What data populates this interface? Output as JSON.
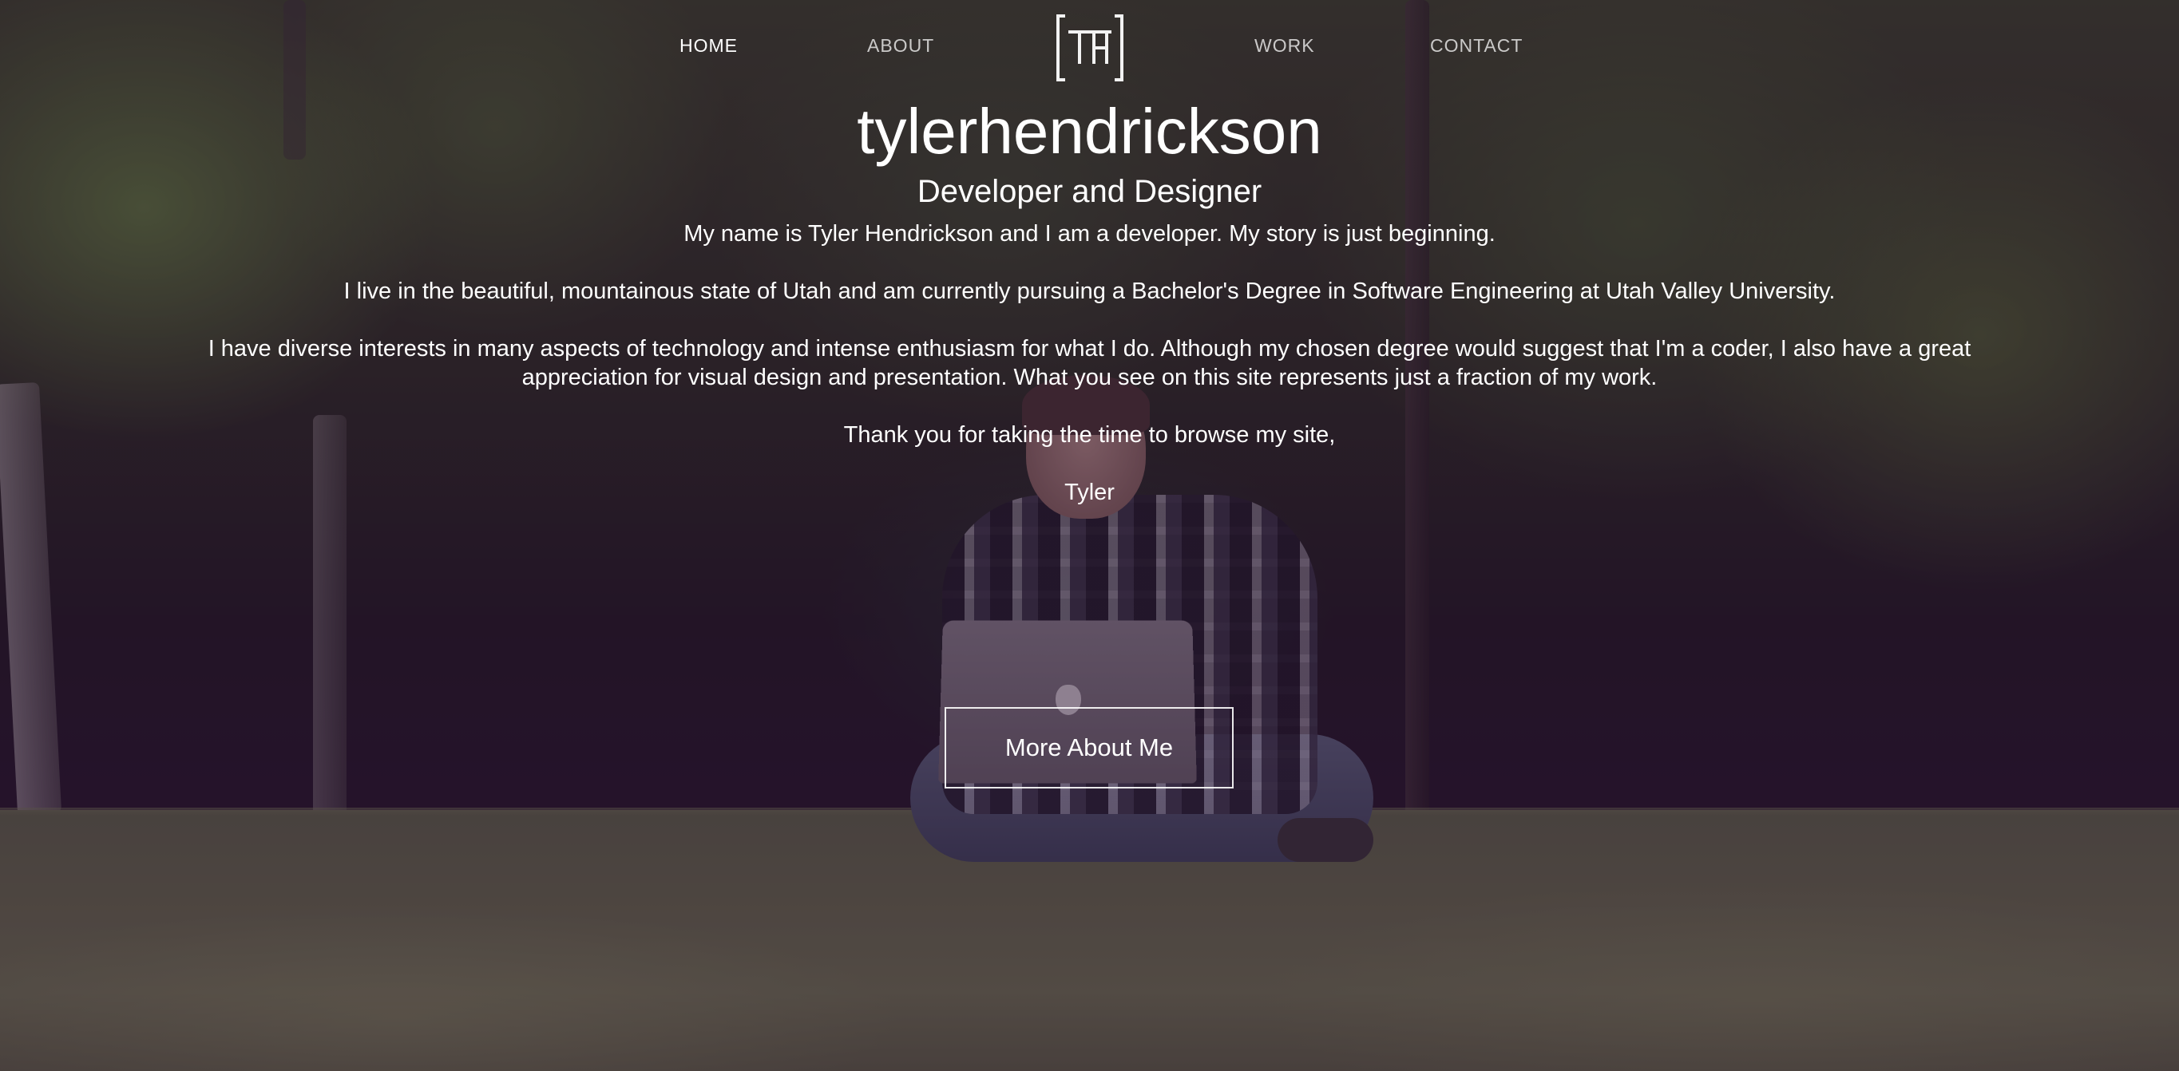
{
  "nav": {
    "items": [
      {
        "label": "HOME",
        "active": true
      },
      {
        "label": "ABOUT",
        "active": false
      },
      {
        "label": "WORK",
        "active": false
      },
      {
        "label": "CONTACT",
        "active": false
      }
    ],
    "logo_icon": "th-monogram-bracket-logo"
  },
  "hero": {
    "title": "tylerhendrickson",
    "subtitle": "Developer and Designer",
    "paragraphs": [
      "My name is Tyler Hendrickson and I am a developer. My story is just beginning.",
      "I live in the beautiful, mountainous state of Utah and am currently pursuing a Bachelor's Degree in Software Engineering at Utah Valley University.",
      "I have diverse interests in many aspects of technology and intense enthusiasm for what I do. Although my chosen degree would suggest that I'm a coder, I also have a great appreciation for visual design and presentation. What you see on this site represents just a fraction of my work.",
      "Thank you for taking the time to browse my site,",
      "Tyler"
    ],
    "cta_label": "More About Me"
  },
  "colors": {
    "text": "#ffffff",
    "overlay": "#280a2d"
  }
}
